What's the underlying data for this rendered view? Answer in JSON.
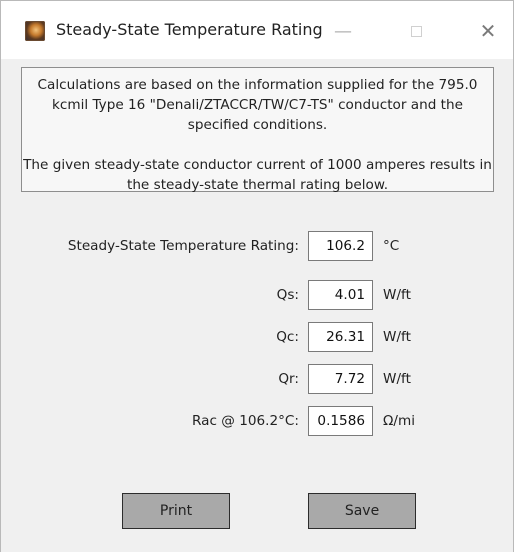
{
  "window": {
    "title": "Steady-State Temperature Rating",
    "controls": {
      "minimize": "—",
      "close": "✕"
    }
  },
  "info": {
    "paragraph1": "Calculations are based on the information supplied for the 795.0 kcmil Type 16 \"Denali/ZTACCR/TW/C7-TS\" conductor and the specified conditions.",
    "paragraph2": "The given steady-state conductor current of 1000 amperes results in the steady-state thermal rating below."
  },
  "results": [
    {
      "label": "Steady-State Temperature Rating:",
      "value": "106.2",
      "unit": "°C"
    },
    {
      "label": "Qs:",
      "value": "4.01",
      "unit": "W/ft"
    },
    {
      "label": "Qc:",
      "value": "26.31",
      "unit": "W/ft"
    },
    {
      "label": "Qr:",
      "value": "7.72",
      "unit": "W/ft"
    },
    {
      "label": "Rac @ 106.2°C:",
      "value": "0.1586",
      "unit": "Ω/mi"
    }
  ],
  "buttons": {
    "print": "Print",
    "save": "Save"
  }
}
